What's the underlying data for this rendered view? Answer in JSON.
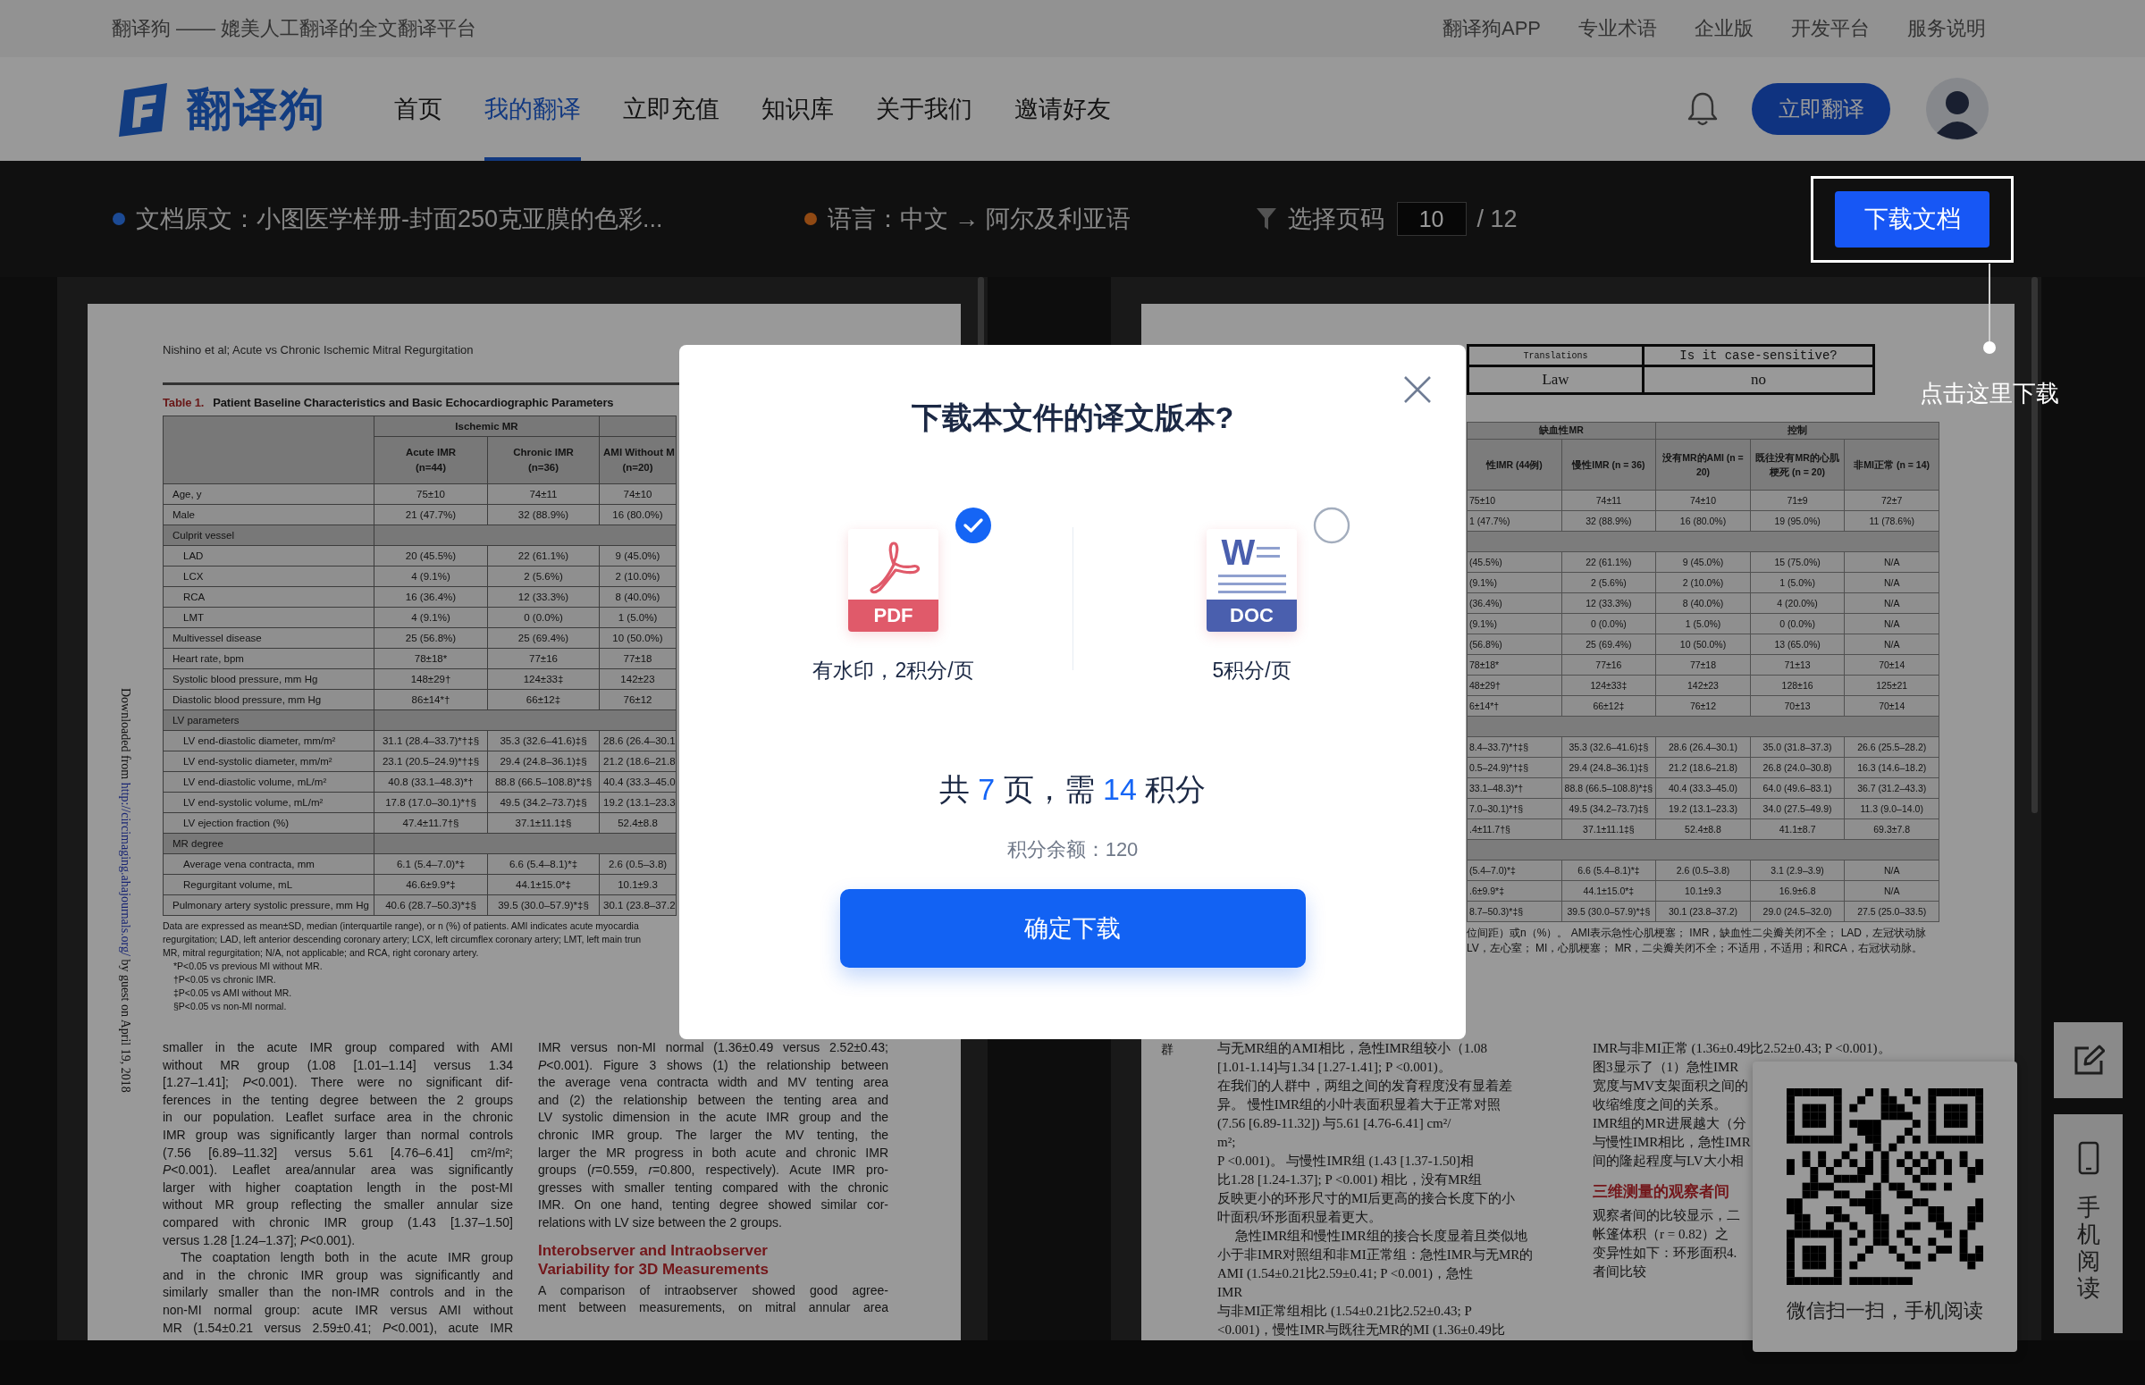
{
  "top_bar": {
    "slogan": "翻译狗 —— 媲美人工翻译的全文翻译平台",
    "links": [
      "翻译狗APP",
      "专业术语",
      "企业版",
      "开发平台",
      "服务说明"
    ]
  },
  "nav": {
    "logo_text": "翻译狗",
    "items": [
      {
        "label": "首页",
        "selected": false
      },
      {
        "label": "我的翻译",
        "selected": true
      },
      {
        "label": "立即充值",
        "selected": false
      },
      {
        "label": "知识库",
        "selected": false
      },
      {
        "label": "关于我们",
        "selected": false
      },
      {
        "label": "邀请好友",
        "selected": false
      }
    ],
    "translate_button": "立即翻译"
  },
  "toolbar": {
    "info": [
      {
        "text": "文档原文：小图医学样册-封面250克亚膜的色彩...",
        "color": "#1c4a94"
      },
      {
        "text": "语言：中文 → 阿尔及利亚语",
        "color": "#904913"
      }
    ],
    "page_label": "选择页码",
    "page_value": "10",
    "page_total": "/ 12",
    "download_button": "下载文档",
    "guide_hint": "点击这里下载"
  },
  "source_page": {
    "side_note": {
      "before": "Downloaded from",
      "link": "http://circimaging.ahajournals.org/",
      "after": "by guest on April 19, 2018"
    },
    "running_head": "Nishino et al; Acute vs Chronic Ischemic Mitral Regurgitation",
    "table": {
      "number": "Table 1.",
      "title": "Patient Baseline Characteristics and Basic Echocardiographic Parameters",
      "group_header": "Ischemic MR",
      "columns": [
        {
          "name": "Acute IMR",
          "count": "(n=44)"
        },
        {
          "name": "Chronic IMR",
          "count": "(n=36)"
        },
        {
          "name": "AMI Without M",
          "count": "(n=20)"
        }
      ],
      "rows": [
        {
          "label": "Age, y",
          "values": [
            "75±10",
            "74±11",
            "74±10"
          ]
        },
        {
          "label": "Male",
          "values": [
            "21 (47.7%)",
            "32 (88.9%)",
            "16 (80.0%)"
          ]
        },
        {
          "label": "Culprit vessel",
          "children": [
            {
              "label": "LAD",
              "values": [
                "20 (45.5%)",
                "22 (61.1%)",
                "9 (45.0%)"
              ]
            },
            {
              "label": "LCX",
              "values": [
                "4 (9.1%)",
                "2 (5.6%)",
                "2 (10.0%)"
              ]
            },
            {
              "label": "RCA",
              "values": [
                "16 (36.4%)",
                "12 (33.3%)",
                "8 (40.0%)"
              ]
            },
            {
              "label": "LMT",
              "values": [
                "4 (9.1%)",
                "0 (0.0%)",
                "1 (5.0%)"
              ]
            }
          ]
        },
        {
          "label": "Multivessel disease",
          "values": [
            "25 (56.8%)",
            "25 (69.4%)",
            "10 (50.0%)"
          ]
        },
        {
          "label": "Heart rate, bpm",
          "values": [
            "78±18*",
            "77±16",
            "77±18"
          ]
        },
        {
          "label": "Systolic blood pressure, mm Hg",
          "values": [
            "148±29†",
            "124±33‡",
            "142±23"
          ]
        },
        {
          "label": "Diastolic blood pressure, mm Hg",
          "values": [
            "86±14*†",
            "66±12‡",
            "76±12"
          ]
        },
        {
          "label": "LV parameters",
          "children": [
            {
              "label": "LV end-diastolic diameter, mm/m²",
              "values": [
                "31.1 (28.4–33.7)*†‡§",
                "35.3 (32.6–41.6)‡§",
                "28.6 (26.4–30.1"
              ]
            },
            {
              "label": "LV end-systolic diameter, mm/m²",
              "values": [
                "23.1 (20.5–24.9)*†‡§",
                "29.4 (24.8–36.1)‡§",
                "21.2 (18.6–21.8"
              ]
            },
            {
              "label": "LV end-diastolic volume, mL/m²",
              "values": [
                "40.8 (33.1–48.3)*†",
                "88.8 (66.5–108.8)*‡§",
                "40.4 (33.3–45.0"
              ]
            },
            {
              "label": "LV end-systolic volume, mL/m²",
              "values": [
                "17.8 (17.0–30.1)*†§",
                "49.5 (34.2–73.7)‡§",
                "19.2 (13.1–23.3"
              ]
            },
            {
              "label": "LV ejection fraction (%)",
              "values": [
                "47.4±11.7†§",
                "37.1±11.1‡§",
                "52.4±8.8"
              ]
            }
          ]
        },
        {
          "label": "MR degree",
          "children": [
            {
              "label": "Average vena contracta, mm",
              "values": [
                "6.1 (5.4–7.0)*‡",
                "6.6 (5.4–8.1)*‡",
                "2.6 (0.5–3.8)"
              ]
            },
            {
              "label": "Regurgitant volume, mL",
              "values": [
                "46.6±9.9*‡",
                "44.1±15.0*‡",
                "10.1±9.3"
              ]
            }
          ]
        },
        {
          "label": "Pulmonary artery systolic pressure, mm Hg",
          "values": [
            "40.6 (28.7–50.3)*‡§",
            "39.5 (30.0–57.9)*‡§",
            "30.1 (23.8–37.2"
          ]
        }
      ]
    },
    "notes": [
      "Data are expressed as mean±SD, median (interquartile range), or n (%) of patients. AMI indicates acute myocardia",
      "regurgitation; LAD, left anterior descending coronary artery; LCX, left circumflex coronary artery; LMT, left main trun",
      "MR, mitral regurgitation; N/A, not applicable; and RCA, right coronary artery.",
      "*P<0.05 vs previous MI without MR.",
      "†P<0.05 vs chronic IMR.",
      "‡P<0.05 vs AMI without MR.",
      "§P<0.05 vs non-MI normal."
    ],
    "body": [
      [
        {
          "kind": "paragraph",
          "indent": false,
          "complete": true,
          "lines": [
            "smaller in the acute IMR group compared with AMI",
            "without MR group (1.08 [1.01–1.14] versus 1.34",
            "[1.27–1.41]; *P*<0.001). There were no significant dif-",
            "ferences in the tenting degree between the 2 groups",
            "in our population. Leaflet surface area in the chronic",
            "IMR group was significantly larger than normal controls",
            "(7.56 [6.89–11.32] versus 5.61 [4.76–6.41] cm²/m²;",
            "*P*<0.001). Leaflet area/annular area was significantly",
            "larger with higher coaptation length in the post-MI",
            "without MR group reflecting the smaller annular size",
            "compared with chronic IMR group (1.43 [1.37–1.50]",
            "versus 1.28 [1.24–1.37]; *P*<0.001)."
          ]
        },
        {
          "kind": "paragraph",
          "indent": true,
          "complete": false,
          "lines": [
            "The coaptation length both in the acute IMR group",
            "and in the chronic IMR group was significantly and",
            "similarly smaller than the non-IMR controls and in the",
            "non-MI normal group: acute IMR versus AMI without",
            "MR (1.54±0.21 versus 2.59±0.41; *P*<0.001), acute IMR"
          ]
        }
      ],
      [
        {
          "kind": "paragraph",
          "indent": false,
          "complete": true,
          "lines": [
            "IMR versus non-MI normal (1.36±0.49 versus 2.52±0.43;",
            "*P*<0.001). Figure 3 shows (1) the relationship between",
            "the average vena contracta width and MV tenting area",
            "and (2) the relationship between the tenting area and",
            "LV systolic dimension in the acute IMR group and the",
            "chronic IMR group. The larger the MV tenting, the",
            "larger the MR progress in both acute and chronic IMR",
            "groups (*r*=0.559, *r*=0.800, respectively). Acute IMR pro-",
            "gresses with smaller tenting compared with the chronic",
            "IMR. On one hand, tenting degree showed similar cor-",
            "relations with LV size between the 2 groups."
          ]
        },
        {
          "kind": "heading",
          "lines": [
            "Interobserver and Intraobserver",
            "Variability for 3D Measurements"
          ]
        },
        {
          "kind": "paragraph",
          "indent": false,
          "complete": false,
          "lines": [
            "A comparison of intraobserver showed good agree-",
            "ment between measurements, on mitral annular area"
          ]
        }
      ]
    ]
  },
  "translated_page": {
    "term_table": {
      "headers": [
        "Translations",
        "Is it case-sensitive?"
      ],
      "values": [
        "Law",
        "no"
      ]
    },
    "table": {
      "group_headers": [
        "缺血性MR",
        "控制"
      ],
      "columns": [
        "性IMR (44例)",
        "慢性IMR (n = 36)",
        "没有MR的AMI (n = 20)",
        "既往没有MR的心肌梗死 (n = 20)",
        "非MI正常 (n = 14)"
      ],
      "rows": [
        {
          "values": [
            "75±10",
            "74±11",
            "74±10",
            "71±9",
            "72±7"
          ]
        },
        {
          "values": [
            "1 (47.7%)",
            "32 (88.9%)",
            "16 (80.0%)",
            "19 (95.0%)",
            "11 (78.6%)"
          ]
        },
        {
          "children": [
            {
              "values": [
                "(45.5%)",
                "22 (61.1%)",
                "9 (45.0%)",
                "15 (75.0%)",
                "N/A"
              ]
            },
            {
              "values": [
                "(9.1%)",
                "2 (5.6%)",
                "2 (10.0%)",
                "1 (5.0%)",
                "N/A"
              ]
            },
            {
              "values": [
                "(36.4%)",
                "12 (33.3%)",
                "8 (40.0%)",
                "4 (20.0%)",
                "N/A"
              ]
            },
            {
              "values": [
                "(9.1%)",
                "0 (0.0%)",
                "1 (5.0%)",
                "0 (0.0%)",
                "N/A"
              ]
            }
          ]
        },
        {
          "values": [
            "(56.8%)",
            "25 (69.4%)",
            "10 (50.0%)",
            "13 (65.0%)",
            "N/A"
          ]
        },
        {
          "values": [
            "78±18*",
            "77±16",
            "77±18",
            "71±13",
            "70±14"
          ]
        },
        {
          "values": [
            "48±29†",
            "124±33‡",
            "142±23",
            "128±16",
            "125±21"
          ]
        },
        {
          "values": [
            "6±14*†",
            "66±12‡",
            "76±12",
            "70±13",
            "70±14"
          ]
        },
        {
          "children": [
            {
              "values": [
                "8.4–33.7)*†‡§",
                "35.3 (32.6–41.6)‡§",
                "28.6 (26.4–30.1)",
                "35.0 (31.8–37.3)",
                "26.6 (25.5–28.2)"
              ]
            },
            {
              "values": [
                "0.5–24.9)*†‡§",
                "29.4 (24.8–36.1)‡§",
                "21.2 (18.6–21.8)",
                "26.8 (24.0–30.8)",
                "16.3 (14.6–18.2)"
              ]
            },
            {
              "values": [
                "33.1–48.3)*†",
                "88.8 (66.5–108.8)*‡§",
                "40.4 (33.3–45.0)",
                "64.0 (49.6–83.1)",
                "36.7 (31.2–43.3)"
              ]
            },
            {
              "values": [
                "7.0–30.1)*†§",
                "49.5 (34.2–73.7)‡§",
                "19.2 (13.1–23.3)",
                "34.0 (27.5–49.9)",
                "11.3 (9.0–14.0)"
              ]
            },
            {
              "values": [
                ".4±11.7†§",
                "37.1±11.1‡§",
                "52.4±8.8",
                "41.1±8.7",
                "69.3±7.8"
              ]
            }
          ]
        },
        {
          "children": [
            {
              "values": [
                "(5.4–7.0)*‡",
                "6.6 (5.4–8.1)*‡",
                "2.6 (0.5–3.8)",
                "3.1 (2.9–3.9)",
                "N/A"
              ]
            },
            {
              "values": [
                ".6±9.9*‡",
                "44.1±15.0*‡",
                "10.1±9.3",
                "16.9±6.8",
                "N/A"
              ]
            }
          ]
        },
        {
          "values": [
            "8.7–50.3)*‡§",
            "39.5 (30.0–57.9)*‡§",
            "30.1 (23.8–37.2)",
            "29.0 (24.5–32.0)",
            "27.5 (25.0–33.5)"
          ]
        }
      ]
    },
    "notes": [
      "位间距）或n（%）。 AMI表示急性心肌梗塞； IMR，缺血性二尖瓣关闭不全； LAD，左冠状动脉",
      "LV，左心室； MI，心肌梗塞； MR，二尖瓣关闭不全；不适用，不适用；和RCA，右冠状动脉。"
    ],
    "side_note": "群",
    "body": [
      [
        {
          "kind": "paragraph",
          "indent": false,
          "lines": [
            "与无MR组的AMI相比，急性IMR组较小（1.08",
            "[1.01-1.14]与1.34 [1.27-1.41]; P <0.001)。",
            "在我们的人群中，两组之间的发育程度没有显着差",
            "异。 慢性IMR组的小叶表面积显着大于正常对照",
            "(7.56 [6.89-11.32]) 与5.61 [4.76-6.41] cm²/",
            "m²;",
            "P <0.001)。 与慢性IMR组 (1.43 [1.37-1.50]相",
            "比1.28 [1.24-1.37]; P <0.001) 相比，没有MR组",
            "反映更小的环形尺寸的MI后更高的接合长度下的小",
            "叶面积/环形面积显着更大。"
          ]
        },
        {
          "kind": "paragraph",
          "indent": true,
          "lines": [
            "急性IMR组和慢性IMR组的接合长度显着且类似地",
            "小于非IMR对照组和非MI正常组：急性IMR与无MR的",
            "AMI (1.54±0.21比2.59±0.41; P <0.001)，急性",
            "IMR",
            "与非MI正常组相比 (1.54±0.21比2.52±0.43; P",
            "<0.001)，慢性IMR与既往无MR的MI (1.36±0.49比"
          ]
        }
      ],
      [
        {
          "kind": "paragraph",
          "indent": false,
          "lines": [
            "IMR与非MI正常 (1.36±0.49比2.52±0.43; P <0.001)。",
            "图3显示了（1）急性IMR",
            "宽度与MV支架面积之间的",
            "收缩维度之间的关系。",
            "IMR组的MR进展越大（分",
            "与慢性IMR相比，急性IMR",
            "间的隆起程度与LV大小相"
          ]
        },
        {
          "kind": "heading",
          "lines": [
            "三维测量的观察者间"
          ]
        },
        {
          "kind": "paragraph",
          "indent": false,
          "lines": [
            "观察者间的比较显示，二",
            "帐篷体积（r = 0.82）之",
            "变异性如下：环形面积4.",
            "者间比较"
          ]
        }
      ]
    ]
  },
  "modal": {
    "title": "下载本文件的译文版本?",
    "options": [
      {
        "kind": "pdf",
        "badge": "PDF",
        "caption": "有水印，2积分/页",
        "selected": true
      },
      {
        "kind": "doc",
        "mark": "W",
        "badge": "DOC",
        "caption": "5积分/页",
        "selected": false
      }
    ],
    "summary": [
      {
        "text": "共 ",
        "kind": "plain"
      },
      {
        "text": "7",
        "kind": "number"
      },
      {
        "text": " 页，需 ",
        "kind": "plain"
      },
      {
        "text": "14",
        "kind": "number"
      },
      {
        "text": " 积分",
        "kind": "plain"
      }
    ],
    "balance": "积分余额：120",
    "confirm_button": "确定下载"
  },
  "qr_popup": {
    "caption": "微信扫一扫，手机阅读"
  },
  "side_tools": [
    {
      "kind": "edit"
    },
    {
      "kind": "mobile",
      "label": "手机阅读"
    }
  ]
}
